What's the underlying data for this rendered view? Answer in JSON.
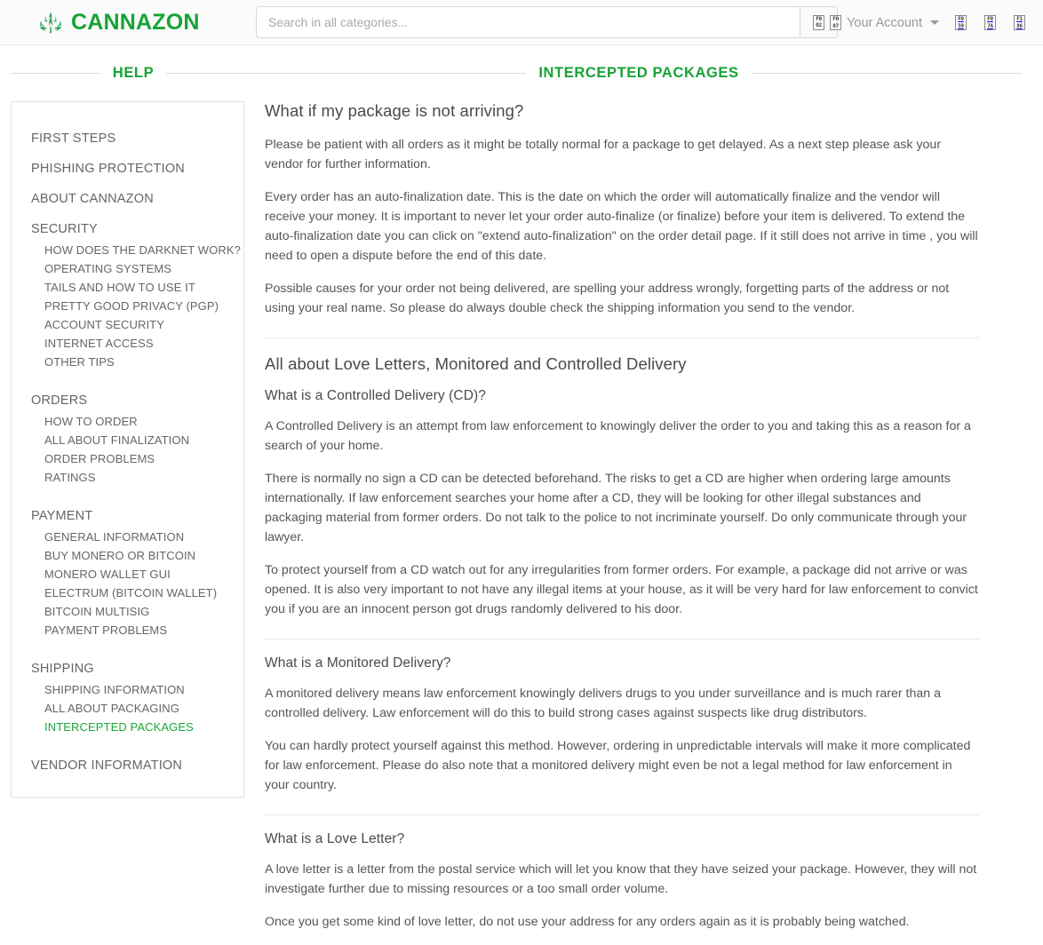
{
  "header": {
    "brand_name": "CANNAZON",
    "brand_icon": "cannabis-leaf-icon",
    "brand_color": "#16a335",
    "search": {
      "placeholder": "Search in all categories...",
      "value": "",
      "button_icon": "search-icon",
      "button_icon_code": "F002"
    },
    "account": {
      "label": "Your Account",
      "icon": "user-icon",
      "icon_code": "F007",
      "caret_icon": "chevron-down-icon"
    },
    "icons": [
      {
        "name": "help-icon",
        "code": "F059"
      },
      {
        "name": "shopping-cart-icon",
        "code": "F07A"
      },
      {
        "name": "night-mode-icon",
        "code": "F186"
      }
    ]
  },
  "sidebar": {
    "heading": "HELP",
    "top_items": [
      {
        "label": "FIRST STEPS",
        "active": false
      },
      {
        "label": "PHISHING PROTECTION",
        "active": false
      },
      {
        "label": "ABOUT CANNAZON",
        "active": false
      }
    ],
    "groups": [
      {
        "title": "SECURITY",
        "items": [
          {
            "label": "HOW DOES THE DARKNET WORK?",
            "active": false
          },
          {
            "label": "OPERATING SYSTEMS",
            "active": false
          },
          {
            "label": "TAILS AND HOW TO USE IT",
            "active": false
          },
          {
            "label": "PRETTY GOOD PRIVACY (PGP)",
            "active": false
          },
          {
            "label": "ACCOUNT SECURITY",
            "active": false
          },
          {
            "label": "INTERNET ACCESS",
            "active": false
          },
          {
            "label": "OTHER TIPS",
            "active": false
          }
        ]
      },
      {
        "title": "ORDERS",
        "items": [
          {
            "label": "HOW TO ORDER",
            "active": false
          },
          {
            "label": "ALL ABOUT FINALIZATION",
            "active": false
          },
          {
            "label": "ORDER PROBLEMS",
            "active": false
          },
          {
            "label": "RATINGS",
            "active": false
          }
        ]
      },
      {
        "title": "PAYMENT",
        "items": [
          {
            "label": "GENERAL INFORMATION",
            "active": false
          },
          {
            "label": "BUY MONERO OR BITCOIN",
            "active": false
          },
          {
            "label": "MONERO WALLET GUI",
            "active": false
          },
          {
            "label": "ELECTRUM (BITCOIN WALLET)",
            "active": false
          },
          {
            "label": "BITCOIN MULTISIG",
            "active": false
          },
          {
            "label": "PAYMENT PROBLEMS",
            "active": false
          }
        ]
      },
      {
        "title": "SHIPPING",
        "items": [
          {
            "label": "SHIPPING INFORMATION",
            "active": false
          },
          {
            "label": "ALL ABOUT PACKAGING",
            "active": false
          },
          {
            "label": "INTERCEPTED PACKAGES",
            "active": true
          }
        ]
      }
    ],
    "bottom_items": [
      {
        "label": "VENDOR INFORMATION",
        "active": false
      }
    ],
    "active_color": "#18a638"
  },
  "main": {
    "heading": "INTERCEPTED PACKAGES",
    "sections": [
      {
        "title": "What if my package is not arriving?",
        "level": "main",
        "paragraphs": [
          "Please be patient with all orders as it might be totally normal for a package to get delayed. As a next step please ask your vendor for further information.",
          "Every order has an auto-finalization date. This is the date on which the order will automatically finalize and the vendor will receive your money. It is important to never let your order auto-finalize (or finalize) before your item is delivered. To extend the auto-finalization date you can click on \"extend auto-finalization\" on the order detail page. If it still does not arrive in time , you will need to open a dispute before the end of this date.",
          "Possible causes for your order not being delivered, are spelling your address wrongly, forgetting parts of the address or not using your real name. So please do always double check the shipping information you send to the vendor."
        ]
      },
      {
        "title": "All about Love Letters, Monitored and Controlled Delivery",
        "level": "main",
        "paragraphs": []
      },
      {
        "title": "What is a Controlled Delivery (CD)?",
        "level": "sub",
        "paragraphs": [
          "A Controlled Delivery is an attempt from law enforcement to knowingly deliver the order to you and taking this as a reason for a search of your home.",
          "There is normally no sign a CD can be detected beforehand. The risks to get a CD are higher when ordering large amounts internationally. If law enforcement searches your home after a CD, they will be looking for other illegal substances and packaging material from former orders. Do not talk to the police to not incriminate yourself. Do only communicate through your lawyer.",
          "To protect yourself from a CD watch out for any irregularities from former orders. For example, a package did not arrive or was opened. It is also very important to not have any illegal items at your house, as it will be very hard for law enforcement to convict you if you are an innocent person got drugs randomly delivered to his door."
        ]
      },
      {
        "title": "What is a Monitored Delivery?",
        "level": "sub",
        "paragraphs": [
          "A monitored delivery means law enforcement knowingly delivers drugs to you under surveillance and is much rarer than a controlled delivery. Law enforcement will do this to build strong cases against suspects like drug distributors.",
          "You can hardly protect yourself against this method. However, ordering in unpredictable intervals will make it more complicated for law enforcement. Please do also note that a monitored delivery might even be not a legal method for law enforcement in your country."
        ]
      },
      {
        "title": "What is a Love Letter?",
        "level": "sub",
        "paragraphs": [
          "A love letter is a letter from the postal service which will let you know that they have seized your package. However, they will not investigate further due to missing resources or a too small order volume.",
          "Once you get some kind of love letter, do not use your address for any orders again as it is probably being watched."
        ]
      }
    ]
  }
}
